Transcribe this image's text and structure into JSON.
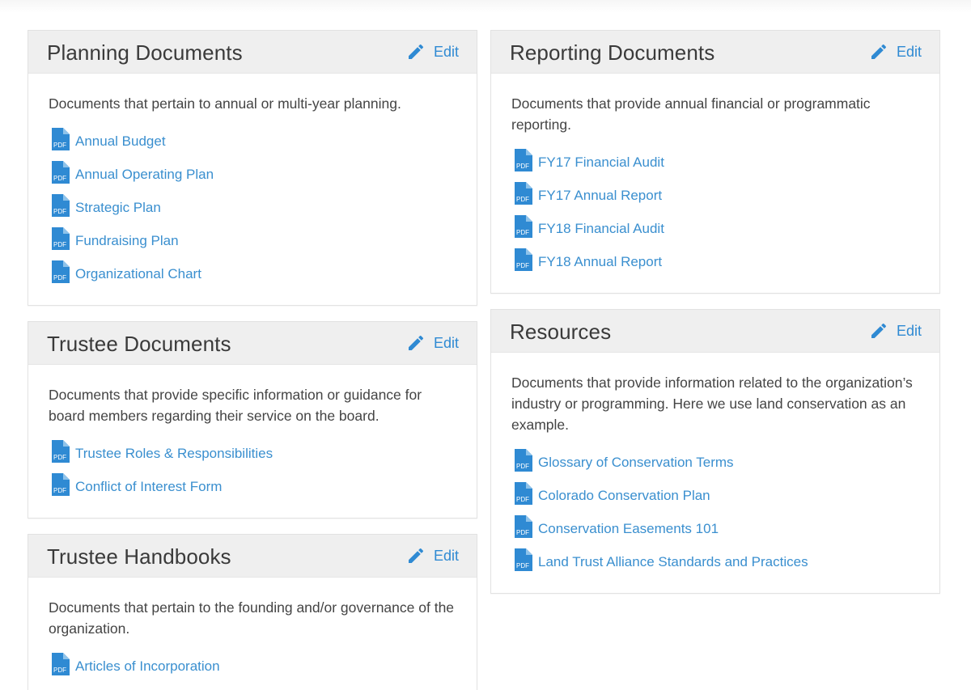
{
  "edit_label": "Edit",
  "colors": {
    "accent": "#2f8ad3",
    "link": "#3a8fcf",
    "header_bg": "#efefef"
  },
  "icons": {
    "edit": "pencil-icon",
    "document": "pdf-file-icon"
  },
  "pdf_label": "PDF",
  "left_column": [
    {
      "title": "Planning Documents",
      "description": "Documents that pertain to annual or multi-year planning.",
      "documents": [
        "Annual Budget",
        "Annual Operating Plan",
        "Strategic Plan",
        "Fundraising Plan",
        "Organizational Chart"
      ]
    },
    {
      "title": "Trustee Documents",
      "description": "Documents that provide specific information or guidance for board members regarding their service on the board.",
      "documents": [
        "Trustee Roles & Responsibilities",
        "Conflict of Interest Form"
      ]
    },
    {
      "title": "Trustee Handbooks",
      "description": "Documents that pertain to the founding and/or governance of the organization.",
      "documents": [
        "Articles of Incorporation"
      ]
    }
  ],
  "right_column": [
    {
      "title": "Reporting Documents",
      "description": "Documents that provide annual financial or programmatic reporting.",
      "documents": [
        "FY17 Financial Audit",
        "FY17 Annual Report",
        "FY18 Financial Audit",
        "FY18 Annual Report"
      ]
    },
    {
      "title": "Resources",
      "description": "Documents that provide information related to the organization’s industry or programming. Here we use land conservation as an example.",
      "documents": [
        "Glossary of Conservation Terms",
        "Colorado Conservation Plan",
        "Conservation Easements 101",
        "Land Trust Alliance Standards and Practices"
      ]
    }
  ]
}
